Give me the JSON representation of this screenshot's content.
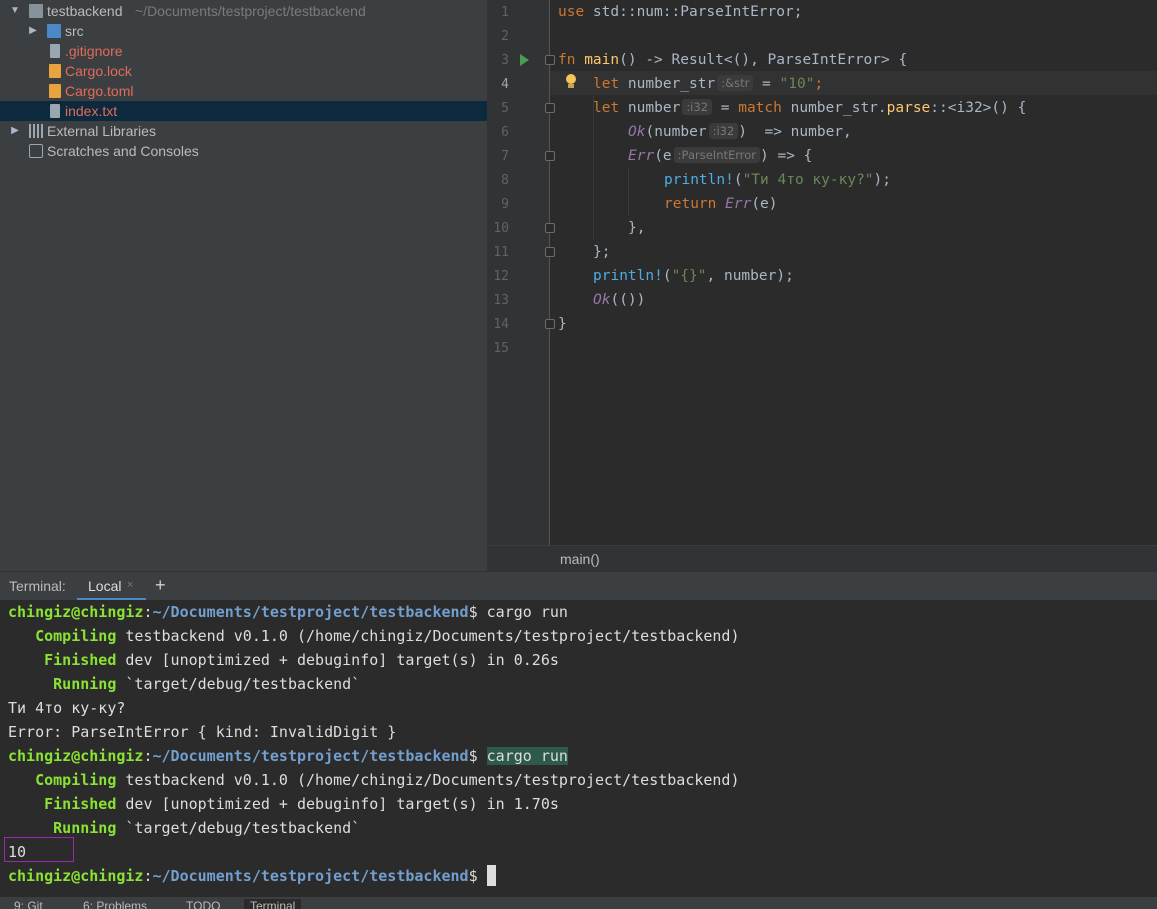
{
  "project_tree": {
    "root": {
      "name": "testbackend",
      "path": "~/Documents/testproject/testbackend"
    },
    "items": [
      {
        "label": "src",
        "kind": "folder"
      },
      {
        "label": ".gitignore",
        "kind": "ignored"
      },
      {
        "label": "Cargo.lock",
        "kind": "cargo"
      },
      {
        "label": "Cargo.toml",
        "kind": "cargo"
      },
      {
        "label": "index.txt",
        "kind": "file",
        "selected": true
      }
    ],
    "external_libraries": "External Libraries",
    "scratches": "Scratches and Consoles"
  },
  "editor": {
    "line_numbers": [
      "1",
      "2",
      "3",
      "4",
      "5",
      "6",
      "7",
      "8",
      "9",
      "10",
      "11",
      "12",
      "13",
      "14",
      "15"
    ],
    "current_line": 4,
    "code": {
      "l1_use": "use",
      "l1_path": " std::num::ParseIntError;",
      "l3_fn": "fn",
      "l3_name": " main",
      "l3_rest": "() -> Result<(), ParseIntError> {",
      "l4_let": "let",
      "l4_var": " number_str",
      "l4_hint": ":&str",
      "l4_eq": " = ",
      "l4_str": "\"10\"",
      "l4_semi": ";",
      "l5_let": "let",
      "l5_var": " number",
      "l5_hint": ":i32",
      "l5_eq": " = ",
      "l5_match": "match",
      "l5_obj": " number_str.",
      "l5_parse": "parse",
      "l5_rest": "::<i32>() {",
      "l6_ok": "Ok",
      "l6_a": "(number",
      "l6_hint": ":i32",
      "l6_b": ")  => number,",
      "l7_err": "Err",
      "l7_a": "(e",
      "l7_hint": ":ParseIntError",
      "l7_b": ") => {",
      "l8_mac": "println!",
      "l8_a": "(",
      "l8_str": "\"Ти 4то ку-ку?\"",
      "l8_b": ");",
      "l9_ret": "return",
      "l9_sp": " ",
      "l9_err": "Err",
      "l9_rest": "(e)",
      "l10": "},",
      "l11": "};",
      "l12_mac": "println!",
      "l12_a": "(",
      "l12_str": "\"{}\"",
      "l12_b": ", number);",
      "l13_ok": "Ok",
      "l13_rest": "(())",
      "l14": "}"
    }
  },
  "breadcrumb": "main()",
  "terminal": {
    "title": "Terminal:",
    "tab": "Local",
    "tab_close": "×",
    "add": "+",
    "prompt_user": "chingiz@chingiz",
    "prompt_sep": ":",
    "prompt_path": "~/Documents/testproject/testbackend",
    "prompt_dollar": "$ ",
    "command": "cargo run",
    "compiling_kw": "Compiling",
    "compiling_rest": " testbackend v0.1.0 (/home/chingiz/Documents/testproject/testbackend)",
    "finished_kw": "Finished",
    "finished_rest_1": " dev [unoptimized + debuginfo] target(s) in 0.26s",
    "finished_rest_2": " dev [unoptimized + debuginfo] target(s) in 1.70s",
    "running_kw": "Running",
    "running_rest": " `target/debug/testbackend`",
    "out_line_1": "Ти 4то ку-ку?",
    "out_line_2": "Error: ParseIntError { kind: InvalidDigit }",
    "out_result": "10"
  },
  "bottom_bar": {
    "git": "9: Git",
    "problems": "6: Problems",
    "todo": "TODO",
    "terminal": "Terminal"
  }
}
